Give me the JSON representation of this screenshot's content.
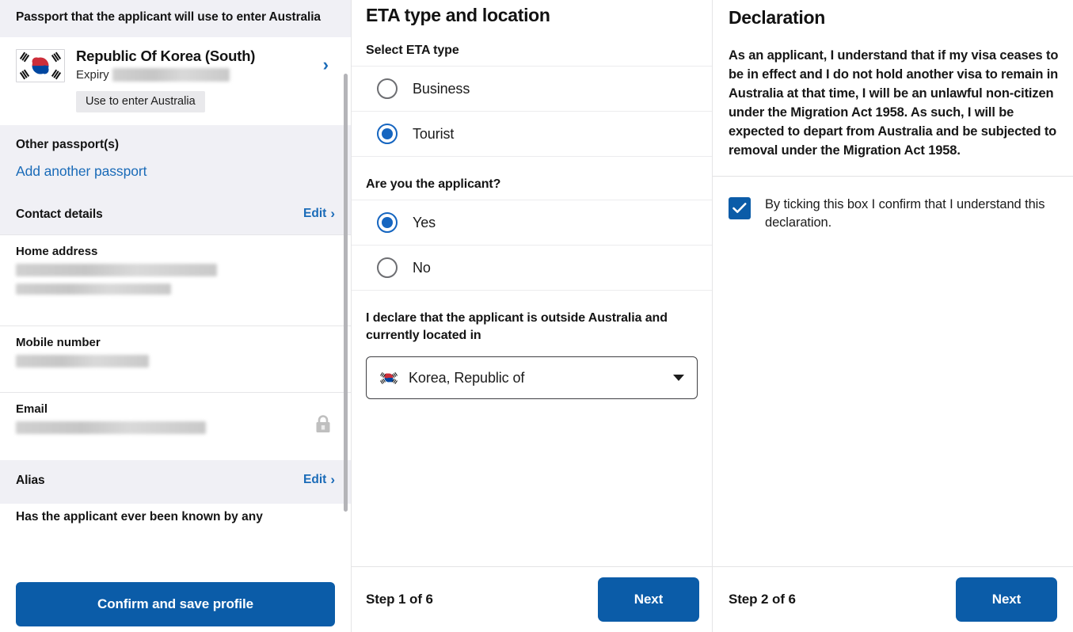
{
  "profile": {
    "passport_section": {
      "heading": "Passport that the applicant will use to enter Australia",
      "country": "Republic Of Korea (South)",
      "expiry_label": "Expiry",
      "expiry_value_redacted": true,
      "badge": "Use to enter Australia",
      "chevron": "›"
    },
    "other_passports": {
      "heading": "Other passport(s)",
      "add_link": "Add another passport"
    },
    "contact_details": {
      "heading": "Contact details",
      "edit_label": "Edit",
      "edit_chevron": "›",
      "fields": [
        {
          "label": "Home address",
          "value_redacted": true,
          "locked": false
        },
        {
          "label": "Mobile number",
          "value_redacted": true,
          "locked": false
        },
        {
          "label": "Email",
          "value_redacted": true,
          "locked": true
        }
      ]
    },
    "alias": {
      "heading": "Alias",
      "edit_label": "Edit",
      "edit_chevron": "›",
      "cut_off_text": "Has the applicant ever been known by any"
    },
    "footer": {
      "confirm_label": "Confirm and save profile"
    }
  },
  "eta": {
    "title": "ETA type and location",
    "select_eta_label": "Select ETA type",
    "eta_options": [
      {
        "label": "Business",
        "selected": false
      },
      {
        "label": "Tourist",
        "selected": true
      }
    ],
    "applicant_question": "Are you the applicant?",
    "applicant_options": [
      {
        "label": "Yes",
        "selected": true
      },
      {
        "label": "No",
        "selected": false
      }
    ],
    "location_label": "I declare that the applicant is outside Australia and currently located in",
    "location_value": "Korea, Republic of",
    "footer": {
      "step": "Step 1 of 6",
      "next_label": "Next"
    }
  },
  "declaration": {
    "title": "Declaration",
    "body": "As an applicant, I understand that if my visa ceases to be in effect and I do not hold another visa to remain in Australia at that time, I will be an unlawful non-citizen under the Migration Act 1958. As such, I will be expected to depart from Australia and be subjected to removal under the Migration Act 1958.",
    "checkbox_checked": true,
    "checkbox_label": "By ticking this box I confirm that I understand this declaration.",
    "footer": {
      "step": "Step 2 of 6",
      "next_label": "Next"
    }
  },
  "colors": {
    "primary_blue": "#0b5ca8",
    "link_blue": "#1a6bb8",
    "radio_blue": "#1565c0",
    "section_bg": "#f0f0f5"
  }
}
